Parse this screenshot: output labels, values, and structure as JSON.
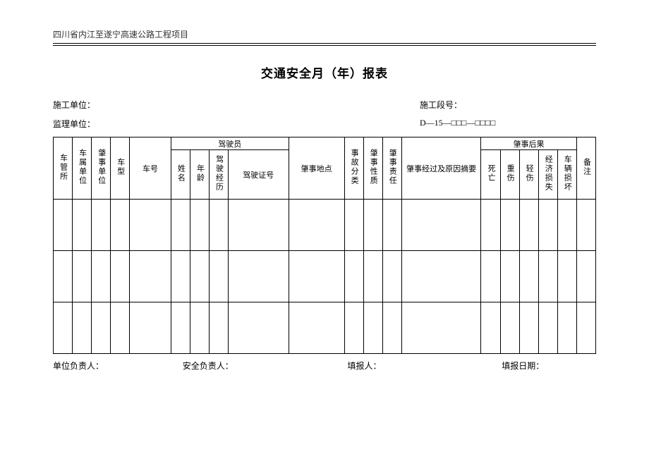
{
  "header": {
    "project": "四川省内江至遂宁高速公路工程项目",
    "title": "交通安全月（年）报表"
  },
  "info": {
    "construction_unit_label": "施工单位：",
    "construction_section_label": "施工段号：",
    "supervision_unit_label": "监理单位：",
    "form_code": "D—15—□□□—□□□□"
  },
  "table": {
    "headers": {
      "vehicle_mgmt": "车管所",
      "vehicle_dept": "车属单位",
      "incident_unit": "肇事单位",
      "vehicle_type": "车型",
      "vehicle_no": "车号",
      "driver_group": "驾驶员",
      "driver_name": "姓名",
      "driver_age": "年龄",
      "driver_exp": "驾驶经历",
      "license_no": "驾驶证号",
      "location": "肇事地点",
      "accident_class": "事故分类",
      "accident_nature": "肇事性质",
      "accident_liability": "肇事责任",
      "summary": "肇事经过及原因摘要",
      "consequence_group": "肇事后果",
      "death": "死亡",
      "severe": "重伤",
      "minor": "轻伤",
      "economic_loss": "经济损失",
      "vehicle_damage": "车辆损坏",
      "remark": "备注"
    }
  },
  "footer": {
    "unit_leader": "单位负责人：",
    "safety_leader": "安全负责人：",
    "filled_by": "填报人：",
    "fill_date": "填报日期："
  }
}
